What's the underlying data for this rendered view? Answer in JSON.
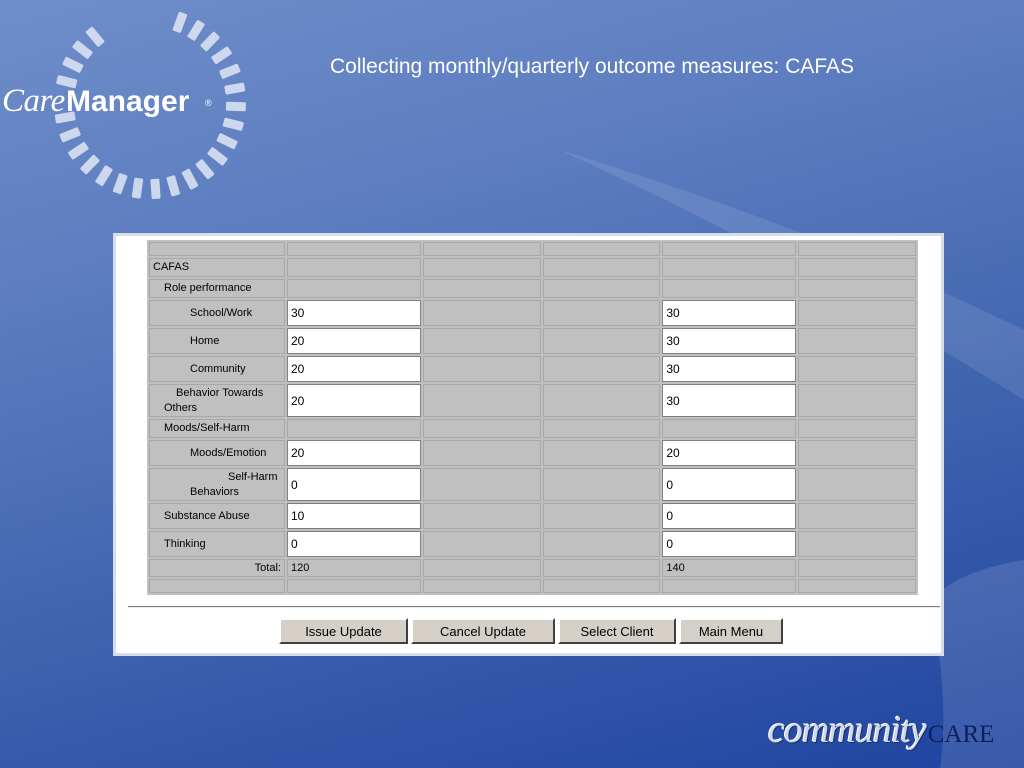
{
  "slide": {
    "title": "Collecting monthly/quarterly outcome measures: CAFAS"
  },
  "logo": {
    "care": "Care",
    "manager": "Manager",
    "registered": "®"
  },
  "brand": {
    "community": "community",
    "care": "CARE"
  },
  "grid": {
    "rows": [
      {
        "label": "",
        "indent": 0,
        "kind": "blank",
        "v1": "",
        "v2": ""
      },
      {
        "label": "CAFAS",
        "indent": 0,
        "kind": "header",
        "v1": "",
        "v2": ""
      },
      {
        "label": "Role performance",
        "indent": 1,
        "kind": "header",
        "v1": "",
        "v2": ""
      },
      {
        "label": "School/Work",
        "indent": 2,
        "kind": "input",
        "v1": "30",
        "v2": "30"
      },
      {
        "label": "Home",
        "indent": 2,
        "kind": "input",
        "v1": "20",
        "v2": "30"
      },
      {
        "label": "Community",
        "indent": 2,
        "kind": "input",
        "v1": "20",
        "v2": "30"
      },
      {
        "label": "Behavior Towards Others",
        "indent": 1,
        "kind": "input",
        "v1": "20",
        "v2": "30"
      },
      {
        "label": "Moods/Self-Harm",
        "indent": 1,
        "kind": "header",
        "v1": "",
        "v2": ""
      },
      {
        "label": "Moods/Emotion",
        "indent": 2,
        "kind": "input",
        "v1": "20",
        "v2": "20"
      },
      {
        "label": "Self-Harm Behaviors",
        "indent": 2,
        "kind": "input",
        "v1": "0",
        "v2": "0"
      },
      {
        "label": "Substance Abuse",
        "indent": 1,
        "kind": "input",
        "v1": "10",
        "v2": "0"
      },
      {
        "label": "Thinking",
        "indent": 1,
        "kind": "input",
        "v1": "0",
        "v2": "0"
      },
      {
        "label": "Total:",
        "indent": 0,
        "kind": "total",
        "v1": "120",
        "v2": "140"
      },
      {
        "label": "",
        "indent": 0,
        "kind": "blank",
        "v1": "",
        "v2": ""
      }
    ]
  },
  "buttons": {
    "issue_update": "Issue Update",
    "cancel_update": "Cancel Update",
    "select_client": "Select Client",
    "main_menu": "Main Menu"
  }
}
